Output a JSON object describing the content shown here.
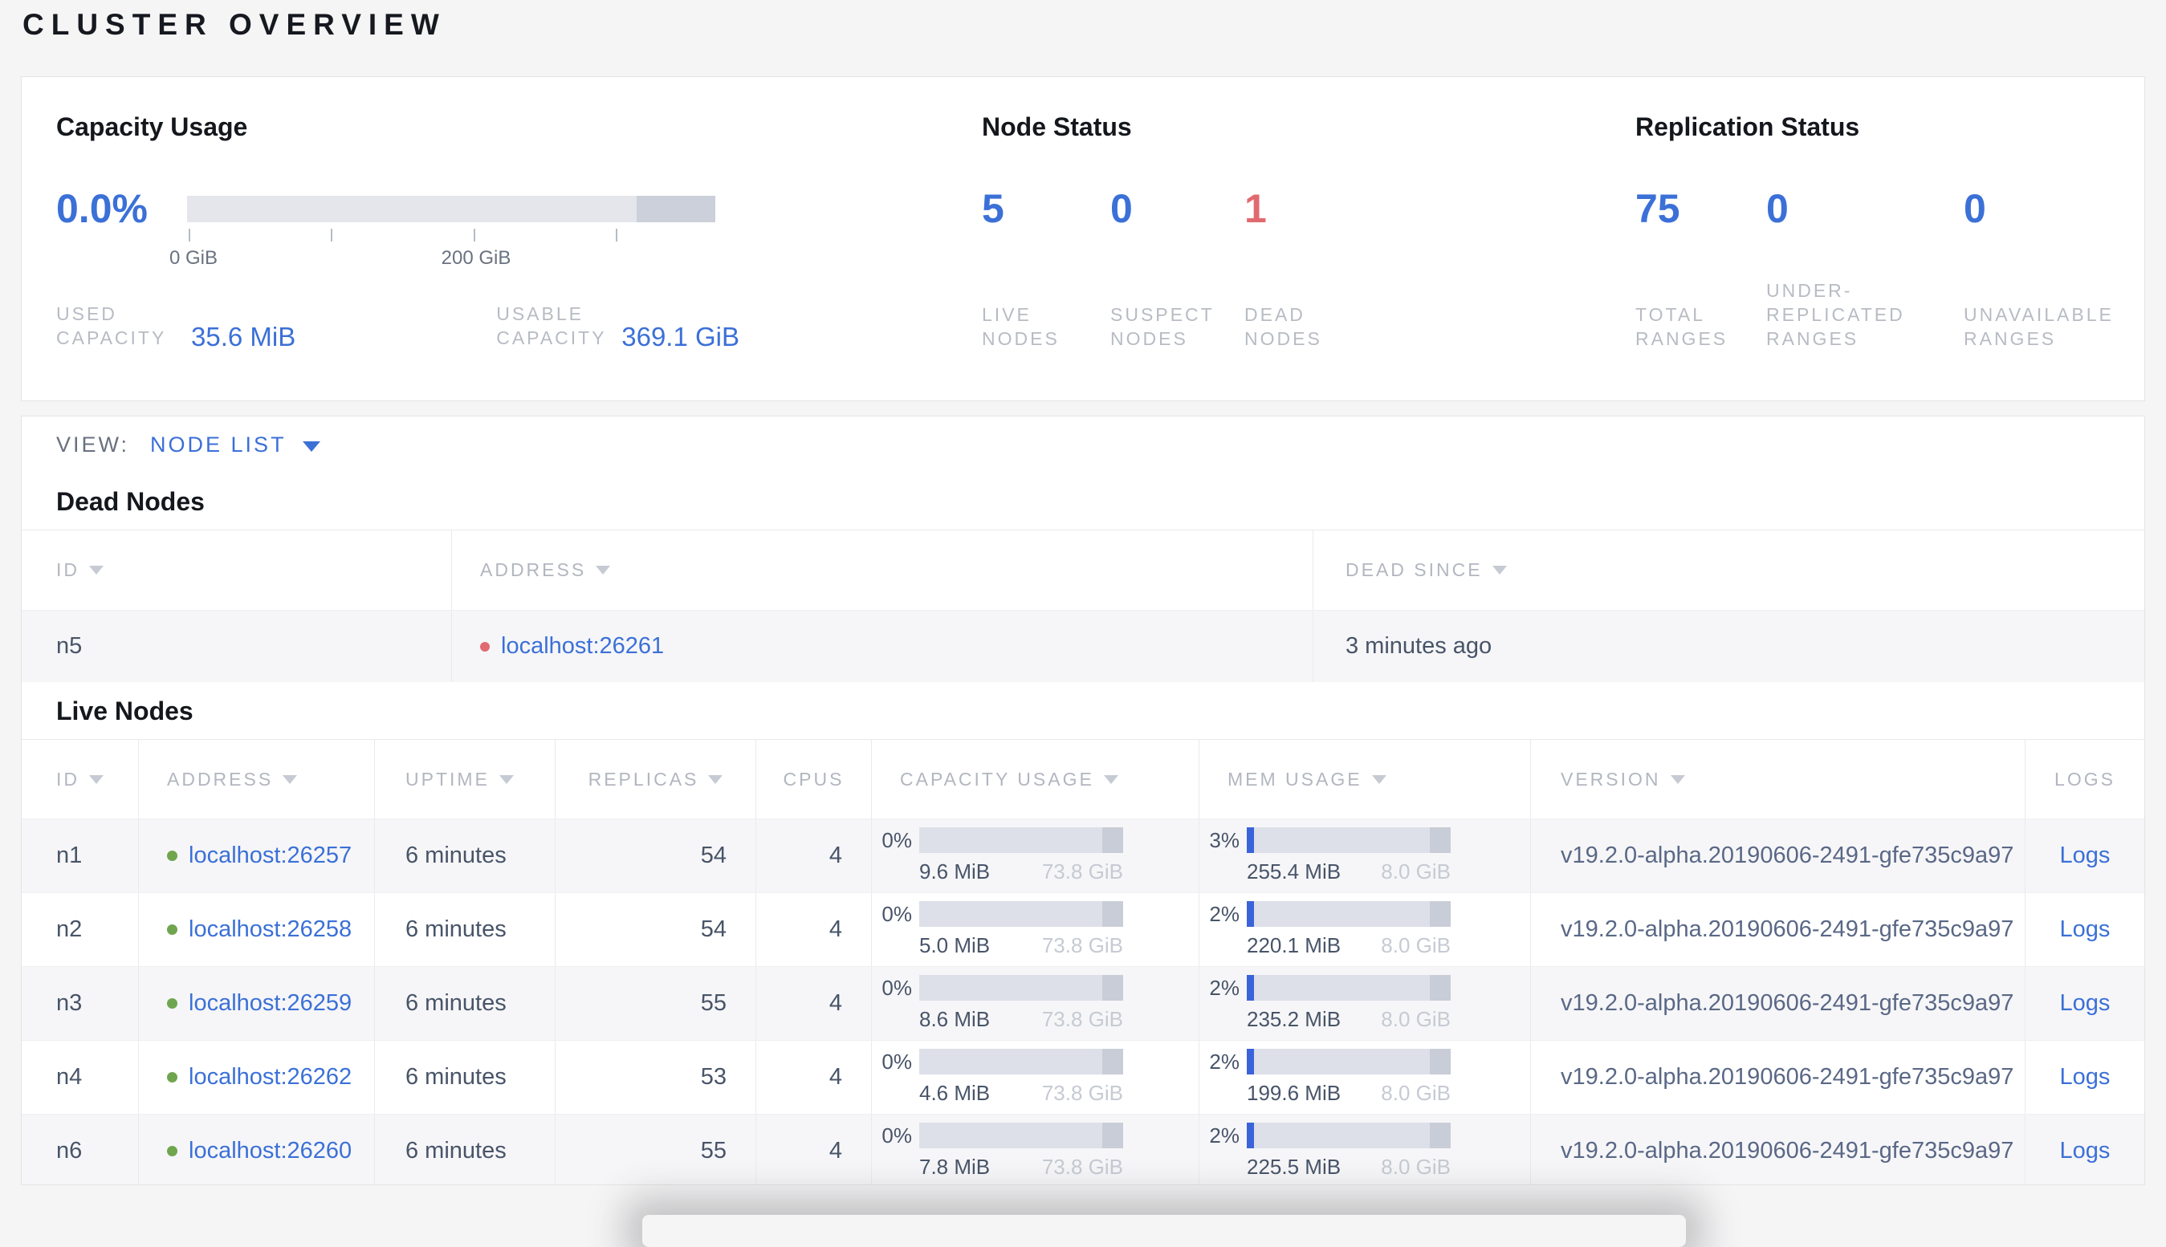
{
  "page_title": "CLUSTER OVERVIEW",
  "colors": {
    "accent_blue": "#3b70d7",
    "danger_red": "#e16a71",
    "live_green": "#70a54f",
    "dead_red": "#e16a71"
  },
  "summary": {
    "capacity": {
      "title": "Capacity Usage",
      "percent": "0.0%",
      "tick_labels": {
        "start": "0 GiB",
        "mid": "200 GiB"
      },
      "used_label": "USED CAPACITY",
      "used_value": "35.6 MiB",
      "usable_label": "USABLE CAPACITY",
      "usable_value": "369.1 GiB"
    },
    "node_status": {
      "title": "Node Status",
      "stats": [
        {
          "value": "5",
          "label": "LIVE NODES"
        },
        {
          "value": "0",
          "label": "SUSPECT NODES"
        },
        {
          "value": "1",
          "label": "DEAD NODES"
        }
      ]
    },
    "replication": {
      "title": "Replication Status",
      "stats": [
        {
          "value": "75",
          "label": "TOTAL RANGES"
        },
        {
          "value": "0",
          "label": "UNDER-REPLICATED RANGES"
        },
        {
          "value": "0",
          "label": "UNAVAILABLE RANGES"
        }
      ]
    }
  },
  "view_bar": {
    "label": "VIEW:",
    "selected": "NODE LIST"
  },
  "dead_nodes": {
    "title": "Dead Nodes",
    "columns": [
      {
        "label": "ID"
      },
      {
        "label": "ADDRESS"
      },
      {
        "label": "DEAD SINCE"
      }
    ],
    "rows": [
      {
        "id": "n5",
        "address": "localhost:26261",
        "dead_since": "3 minutes ago"
      }
    ]
  },
  "live_nodes": {
    "title": "Live Nodes",
    "columns": [
      {
        "label": "ID"
      },
      {
        "label": "ADDRESS"
      },
      {
        "label": "UPTIME"
      },
      {
        "label": "REPLICAS"
      },
      {
        "label": "CPUS"
      },
      {
        "label": "CAPACITY USAGE"
      },
      {
        "label": "MEM USAGE"
      },
      {
        "label": "VERSION"
      },
      {
        "label": "LOGS"
      }
    ],
    "rows": [
      {
        "id": "n1",
        "address": "localhost:26257",
        "uptime": "6 minutes",
        "replicas": "54",
        "cpus": "4",
        "capacity": {
          "percent": "0%",
          "used": "9.6 MiB",
          "total": "73.8 GiB"
        },
        "memory": {
          "percent": "3%",
          "used": "255.4 MiB",
          "total": "8.0 GiB"
        },
        "version": "v19.2.0-alpha.20190606-2491-gfe735c9a97",
        "logs": "Logs"
      },
      {
        "id": "n2",
        "address": "localhost:26258",
        "uptime": "6 minutes",
        "replicas": "54",
        "cpus": "4",
        "capacity": {
          "percent": "0%",
          "used": "5.0 MiB",
          "total": "73.8 GiB"
        },
        "memory": {
          "percent": "2%",
          "used": "220.1 MiB",
          "total": "8.0 GiB"
        },
        "version": "v19.2.0-alpha.20190606-2491-gfe735c9a97",
        "logs": "Logs"
      },
      {
        "id": "n3",
        "address": "localhost:26259",
        "uptime": "6 minutes",
        "replicas": "55",
        "cpus": "4",
        "capacity": {
          "percent": "0%",
          "used": "8.6 MiB",
          "total": "73.8 GiB"
        },
        "memory": {
          "percent": "2%",
          "used": "235.2 MiB",
          "total": "8.0 GiB"
        },
        "version": "v19.2.0-alpha.20190606-2491-gfe735c9a97",
        "logs": "Logs"
      },
      {
        "id": "n4",
        "address": "localhost:26262",
        "uptime": "6 minutes",
        "replicas": "53",
        "cpus": "4",
        "capacity": {
          "percent": "0%",
          "used": "4.6 MiB",
          "total": "73.8 GiB"
        },
        "memory": {
          "percent": "2%",
          "used": "199.6 MiB",
          "total": "8.0 GiB"
        },
        "version": "v19.2.0-alpha.20190606-2491-gfe735c9a97",
        "logs": "Logs"
      },
      {
        "id": "n6",
        "address": "localhost:26260",
        "uptime": "6 minutes",
        "replicas": "55",
        "cpus": "4",
        "capacity": {
          "percent": "0%",
          "used": "7.8 MiB",
          "total": "73.8 GiB"
        },
        "memory": {
          "percent": "2%",
          "used": "225.5 MiB",
          "total": "8.0 GiB"
        },
        "version": "v19.2.0-alpha.20190606-2491-gfe735c9a97",
        "logs": "Logs"
      }
    ]
  }
}
